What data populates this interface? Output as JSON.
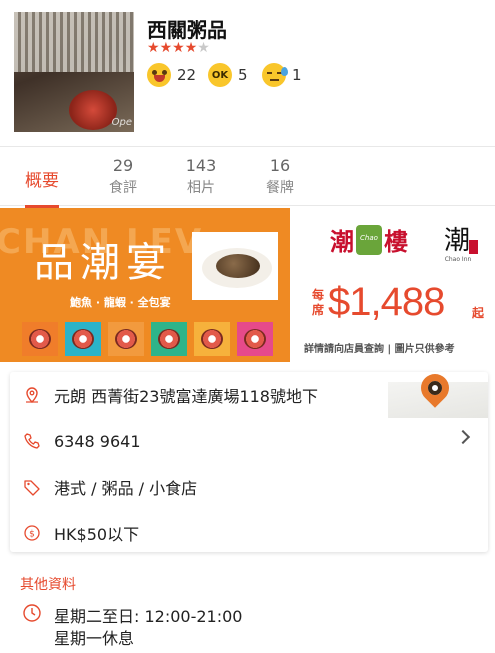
{
  "restaurant": {
    "name": "西關粥品",
    "rating": 3.5,
    "rating_max": 5
  },
  "reactions": [
    {
      "icon": "smile-face-icon",
      "count": "22"
    },
    {
      "icon": "ok-face-icon",
      "label": "OK",
      "count": "5"
    },
    {
      "icon": "sad-face-icon",
      "count": "1"
    }
  ],
  "thumbnail": {
    "watermark": "Ope"
  },
  "tabs": [
    {
      "label": "概要",
      "count": ""
    },
    {
      "label": "食評",
      "count": "29"
    },
    {
      "label": "相片",
      "count": "143"
    },
    {
      "label": "餐牌",
      "count": "16"
    }
  ],
  "banner": {
    "bg_text": "CHAN LEV",
    "title": "品潮宴",
    "subtitle": "鮑魚 · 龍蝦 · 全包宴",
    "brand1_left": "潮",
    "brand1_right": "樓",
    "brand2_mark": "潮",
    "brand2_sub": "Chao Inn",
    "price_lead": "每席",
    "price": "$1,488",
    "price_tail": "起",
    "disclaimer": "詳情請向店員查詢 | 圖片只供參考"
  },
  "info": {
    "address": "元朗 西菁街23號富達廣場118號地下",
    "phone": "6348 9641",
    "categories": "港式 / 粥品 / 小食店",
    "price_range": "HK$50以下"
  },
  "other": {
    "title": "其他資料",
    "hours_line1": "星期二至日: 12:00-21:00",
    "hours_line2": "星期一休息"
  },
  "colors": {
    "accent": "#e64a2e",
    "banner_orange": "#ef8a23",
    "emoji_yellow": "#f9c62b"
  }
}
